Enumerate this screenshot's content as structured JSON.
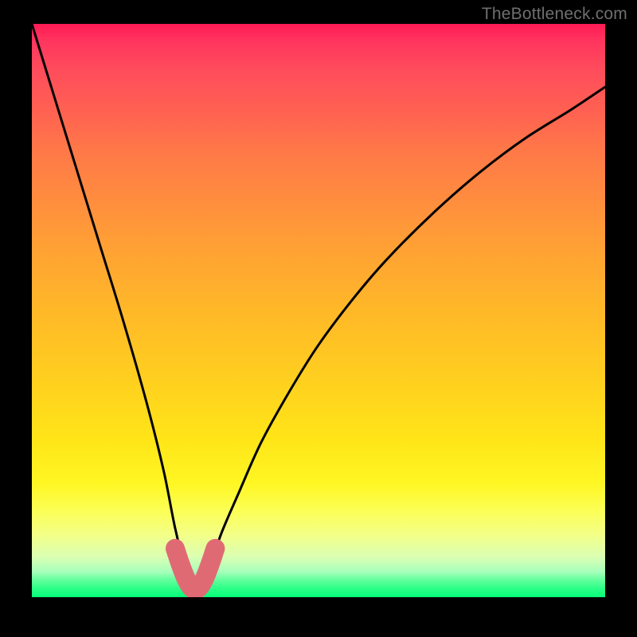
{
  "watermark": "TheBottleneck.com",
  "colors": {
    "background": "#000000",
    "gradient_top": "#ff1a55",
    "gradient_mid": "#ffd21a",
    "gradient_bottom": "#06ff79",
    "curve": "#000000",
    "marker": "#e06a74"
  },
  "chart_data": {
    "type": "line",
    "title": "",
    "xlabel": "",
    "ylabel": "",
    "xlim": [
      0,
      100
    ],
    "ylim": [
      0,
      100
    ],
    "grid": false,
    "legend": false,
    "description": "V-shaped bottleneck curve over vertical red-to-green gradient; minimum near x≈28, y≈0.",
    "series": [
      {
        "name": "bottleneck-curve",
        "x": [
          0,
          4,
          8,
          12,
          16,
          20,
          23,
          25,
          27,
          28,
          29,
          31,
          33,
          36,
          40,
          45,
          50,
          56,
          62,
          70,
          78,
          86,
          94,
          100
        ],
        "values": [
          100,
          87,
          74,
          61,
          48,
          34,
          22,
          12,
          4,
          1,
          1,
          5,
          11,
          18,
          27,
          36,
          44,
          52,
          59,
          67,
          74,
          80,
          85,
          89
        ]
      }
    ],
    "marker": {
      "name": "minimum-region",
      "x": [
        25,
        26,
        27,
        28,
        29,
        30,
        31,
        32
      ],
      "values": [
        8.5,
        5.5,
        3,
        1.5,
        1.5,
        3,
        5.5,
        8.5
      ],
      "style": "thick-rounded"
    }
  }
}
